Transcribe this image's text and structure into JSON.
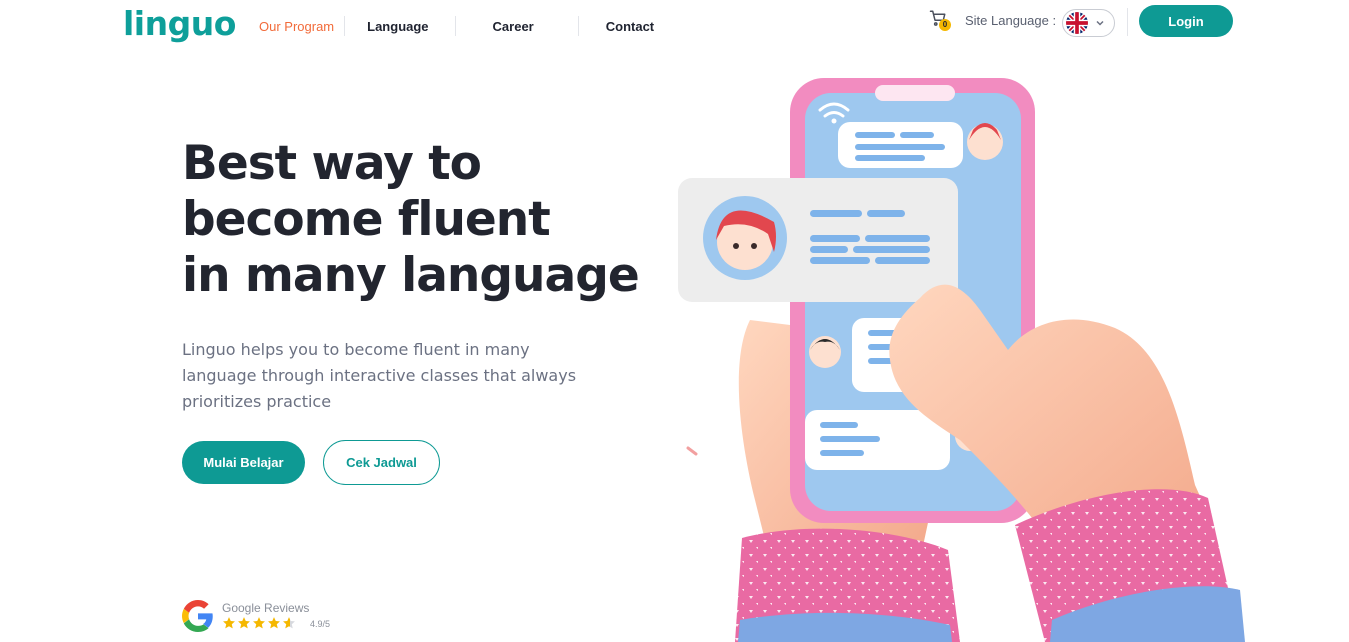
{
  "header": {
    "logo": "linguo",
    "nav": [
      {
        "label": "Our Program",
        "active": true
      },
      {
        "label": "Language",
        "active": false
      },
      {
        "label": "Career",
        "active": false
      },
      {
        "label": "Contact",
        "active": false
      }
    ],
    "cart_count": "0",
    "site_language_label": "Site Language :",
    "language_flag": "uk-flag-icon",
    "login_label": "Login"
  },
  "hero": {
    "headline": [
      "Best way to",
      "become fluent",
      "in many language"
    ],
    "description": "Linguo helps you to become fluent in many language through interactive classes that always prioritizes practice",
    "primary_button": "Mulai Belajar",
    "secondary_button": "Cek Jadwal"
  },
  "reviews": {
    "label": "Google Reviews",
    "score": "4.9/5",
    "rating": 4.9,
    "max": 5
  },
  "colors": {
    "brand_teal": "#0e9a94",
    "active_nav": "#f26b3a",
    "star": "#f5b800"
  }
}
